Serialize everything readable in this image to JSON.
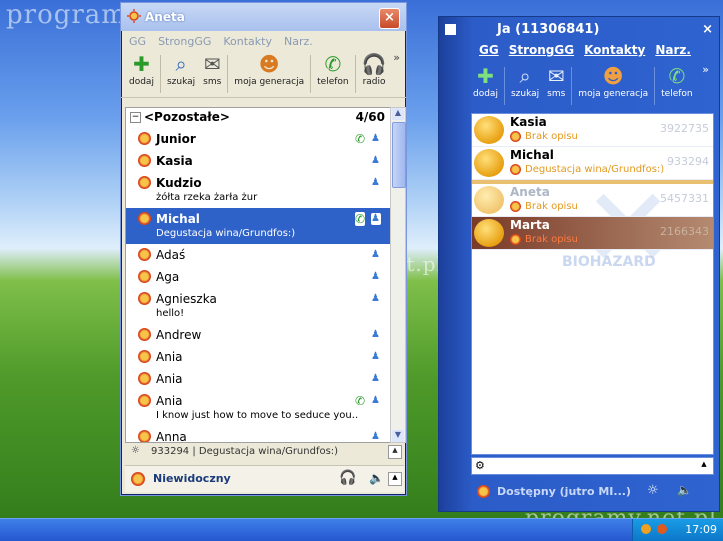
{
  "watermark": "programy.net.pl",
  "window1": {
    "title": "Aneta",
    "menu": [
      "GG",
      "StrongGG",
      "Kontakty",
      "Narz."
    ],
    "toolbar": [
      "dodaj",
      "szukaj",
      "sms",
      "moja generacja",
      "telefon",
      "radio"
    ],
    "group": {
      "name": "<Pozostałe>",
      "count": "4/60"
    },
    "contacts": [
      {
        "name": "Junior",
        "desc": "",
        "bold": true,
        "phone": true
      },
      {
        "name": "Kasia",
        "desc": "",
        "bold": true,
        "phone": false
      },
      {
        "name": "Kudzio",
        "desc": "żółta rzeka żarła żur",
        "bold": true,
        "phone": false
      },
      {
        "name": "Michal",
        "desc": "Degustacja wina/Grundfos:)",
        "bold": true,
        "phone": true,
        "selected": true
      },
      {
        "name": "Adaś",
        "desc": "",
        "bold": false,
        "phone": false
      },
      {
        "name": "Aga",
        "desc": "",
        "bold": false,
        "phone": false
      },
      {
        "name": "Agnieszka",
        "desc": "hello!",
        "bold": false,
        "phone": false
      },
      {
        "name": "Andrew",
        "desc": "",
        "bold": false,
        "phone": false
      },
      {
        "name": "Ania",
        "desc": "",
        "bold": false,
        "phone": false
      },
      {
        "name": "Ania",
        "desc": "",
        "bold": false,
        "phone": false
      },
      {
        "name": "Ania",
        "desc": "I know just how to move to seduce you..",
        "bold": false,
        "phone": true
      },
      {
        "name": "Anna",
        "desc": "",
        "bold": false,
        "phone": false
      }
    ],
    "status_line": "933294 | Degustacja wina/Grundfos:)",
    "presence": "Niewidoczny"
  },
  "window2": {
    "title": "Ja (11306841)",
    "menu": [
      "GG",
      "StrongGG",
      "Kontakty",
      "Narz."
    ],
    "toolbar": [
      "dodaj",
      "szukaj",
      "sms",
      "moja generacja",
      "telefon"
    ],
    "contacts": [
      {
        "name": "Kasia",
        "desc": "Brak opisu",
        "num": "3922735",
        "style": "normal"
      },
      {
        "name": "Michal",
        "desc": "Degustacja wina/Grundfos:)",
        "num": "933294",
        "style": "sel"
      },
      {
        "name": "Aneta",
        "desc": "Brak opisu",
        "num": "5457331",
        "style": "gold"
      },
      {
        "name": "Marta",
        "desc": "Brak opisu",
        "num": "2166343",
        "style": "brown"
      }
    ],
    "bg_mark": "BIOHAZARD",
    "presence": "Dostępny (jutro MI...)"
  },
  "clock": "17:09"
}
